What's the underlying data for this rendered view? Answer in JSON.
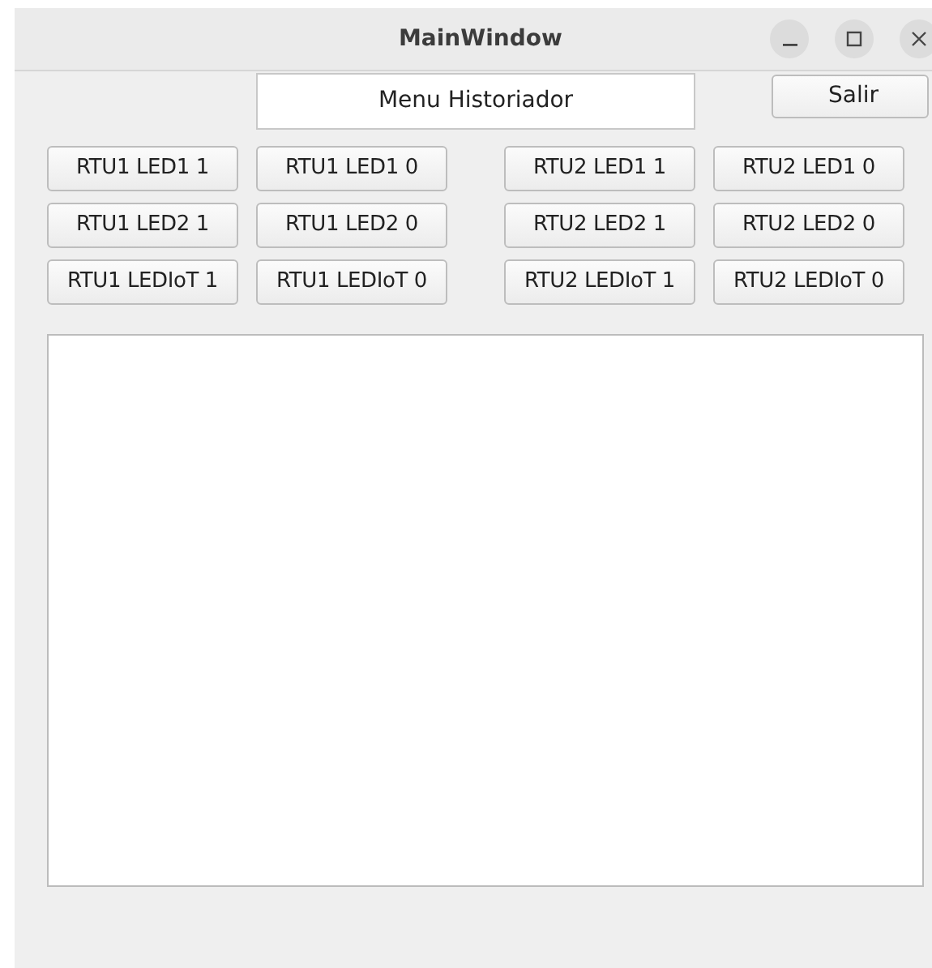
{
  "window": {
    "title": "MainWindow"
  },
  "header": {
    "label": "Menu Historiador",
    "exit_button": "Salir"
  },
  "button_groups": [
    {
      "rows": [
        [
          "RTU1 LED1 1",
          "RTU1 LED1 0"
        ],
        [
          "RTU1 LED2 1",
          "RTU1 LED2 0"
        ],
        [
          "RTU1 LEDIoT 1",
          "RTU1 LEDIoT 0"
        ]
      ]
    },
    {
      "rows": [
        [
          "RTU2 LED1 1",
          "RTU2 LED1 0"
        ],
        [
          "RTU2 LED2 1",
          "RTU2 LED2 0"
        ],
        [
          "RTU2 LEDIoT 1",
          "RTU2 LEDIoT 0"
        ]
      ]
    }
  ]
}
